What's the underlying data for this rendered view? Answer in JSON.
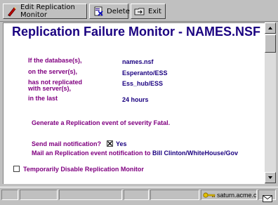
{
  "toolbar": {
    "edit_label": "Edit Replication Monitor",
    "delete_label": "Delete",
    "exit_label": "Exit"
  },
  "document": {
    "title": "Replication Failure Monitor - NAMES.NSF",
    "fields": [
      {
        "label": "If the database(s),",
        "value": "names.nsf"
      },
      {
        "label": "on the server(s),",
        "value": "Esperanto/ESS"
      },
      {
        "label": "has not replicated with server(s),",
        "value": "Ess_hub/ESS"
      },
      {
        "label": "in the last",
        "value": "24 hours"
      }
    ],
    "event_prefix": "Generate a Replication event of severity",
    "event_severity": "Fatal",
    "send_mail_label": "Send mail notification?",
    "send_mail_value": "Yes",
    "mail_prefix": "Mail an Replication event notification to",
    "mail_recipient": "Bill Clinton/WhiteHouse/Gov",
    "disable_label": "Temporarily Disable Replication Monitor"
  },
  "statusbar": {
    "server": "saturn.acme.c"
  }
}
